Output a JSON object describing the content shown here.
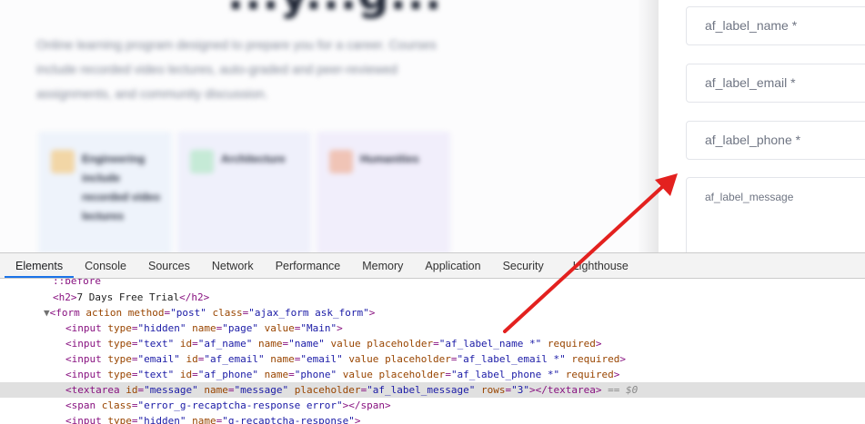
{
  "page": {
    "hero_title": "...y...g...",
    "hero_description": "Online learning program designed to prepare you for a career. Courses include recorded video lectures, auto-graded and peer-reviewed assignments, and community discussion.",
    "cards": [
      {
        "label": "Engineering include recorded video lectures",
        "icon": "engineering-icon",
        "bg": "#eef3fb",
        "icon_color": "#e8a33d"
      },
      {
        "label": "Architecture",
        "icon": "architecture-icon",
        "bg": "#eff0fb",
        "icon_color": "#5bbf8b"
      },
      {
        "label": "Humanities",
        "icon": "humanities-icon",
        "bg": "#f1eefb",
        "icon_color": "#d96b4e"
      }
    ],
    "form": {
      "name_placeholder": "af_label_name *",
      "email_placeholder": "af_label_email *",
      "phone_placeholder": "af_label_phone *",
      "message_placeholder": "af_label_message"
    }
  },
  "devtools": {
    "tabs": [
      "Elements",
      "Console",
      "Sources",
      "Network",
      "Performance",
      "Memory",
      "Application",
      "Security",
      "Lighthouse"
    ],
    "active_tab": "Elements",
    "accent": "#1a73e8",
    "lines": {
      "before": "::before",
      "h2_text": "7 Days Free Trial",
      "form_action": "action",
      "form_method_attr": "method",
      "form_method_val": "\"post\"",
      "form_class_val": "\"ajax_form ask_form\"",
      "input_page_val": "\"Main\"",
      "name_ph": "\"af_label_name *\"",
      "email_ph": "\"af_label_email *\"",
      "phone_ph": "\"af_label_phone *\"",
      "message_ph": "\"af_label_message\"",
      "rows_val": "\"3\"",
      "selected_marker": "== $0",
      "span_class_val": "\"error_g-recaptcha-response error\"",
      "recaptcha_name_val": "\"g-recaptcha-response\""
    }
  },
  "annotation": {
    "arrow_color": "#e3211f"
  }
}
